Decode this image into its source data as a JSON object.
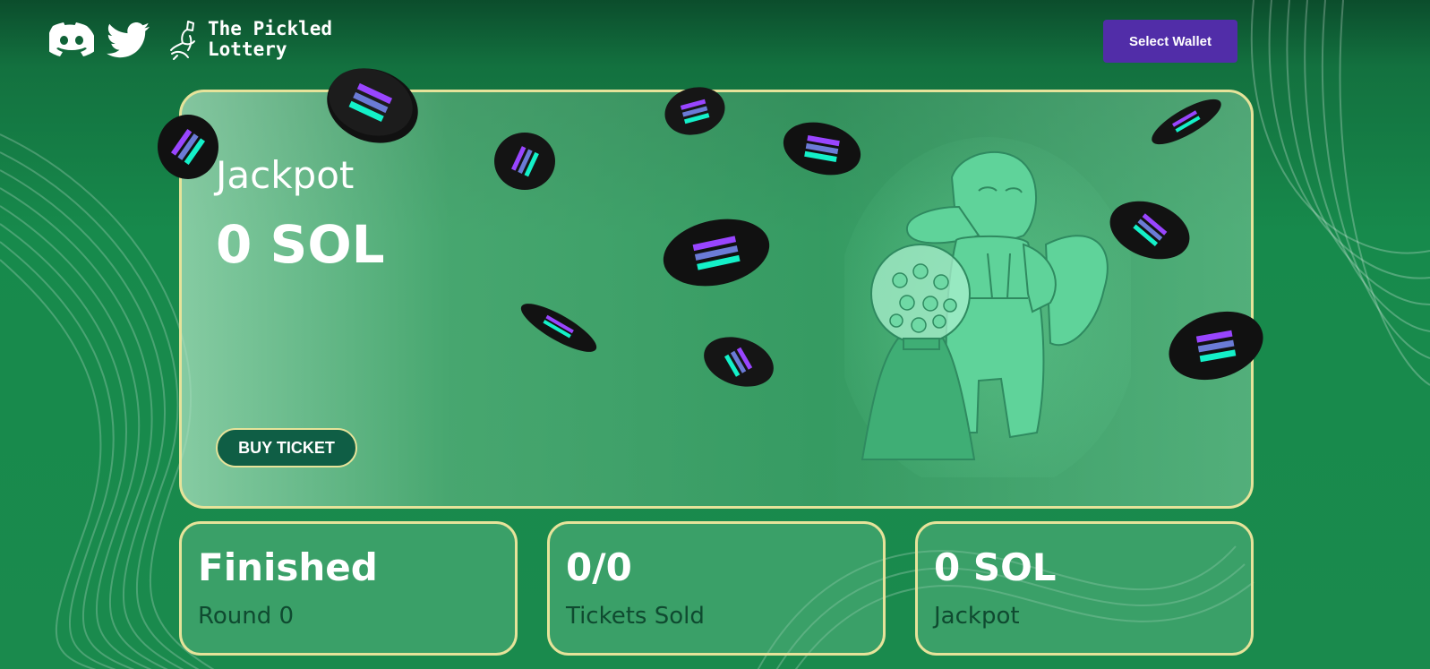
{
  "header": {
    "brand_line1": "The Pickled",
    "brand_line2": "Lottery",
    "discord_icon": "discord-icon",
    "twitter_icon": "twitter-icon",
    "logo_icon": "platypus-logo-icon",
    "wallet_button": "Select Wallet"
  },
  "hero": {
    "title": "Jackpot",
    "amount": "0 SOL",
    "buy_button": "BUY TICKET",
    "mascot_icon": "platypus-mascot-illustration",
    "coin_icon": "solana-coin-icon"
  },
  "stats": [
    {
      "value": "Finished",
      "label": "Round 0"
    },
    {
      "value": "0/0",
      "label": "Tickets Sold"
    },
    {
      "value": "0 SOL",
      "label": "Jackpot"
    }
  ],
  "colors": {
    "background": "#178a4c",
    "card_border": "#e6e39a",
    "wallet_button": "#512da8",
    "buy_button": "#0f5e45",
    "stat_label": "#0f4a30"
  }
}
